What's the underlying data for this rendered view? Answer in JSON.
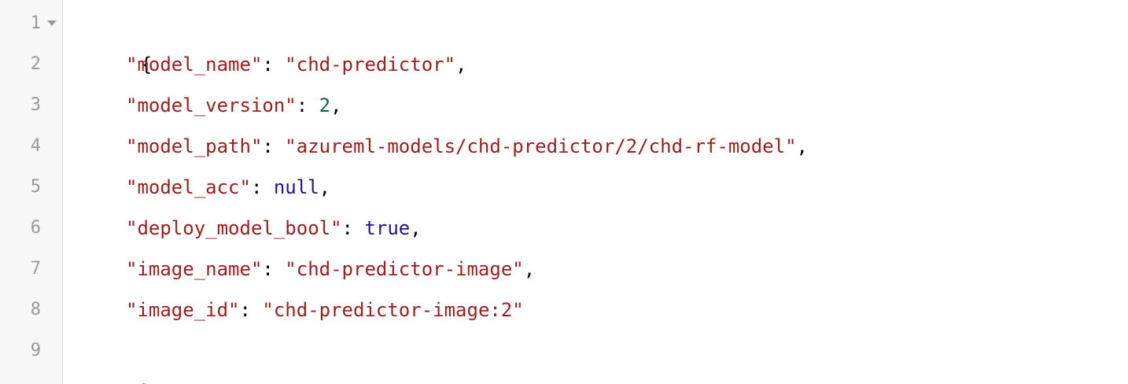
{
  "gutter": {
    "line_numbers": [
      "1",
      "2",
      "3",
      "4",
      "5",
      "6",
      "7",
      "8",
      "9"
    ]
  },
  "code": {
    "open_brace": "{",
    "close_brace": "}",
    "entries": [
      {
        "key": "\"model_name\"",
        "value": "\"chd-predictor\"",
        "comma": ","
      },
      {
        "key": "\"model_version\"",
        "value": "2",
        "comma": ","
      },
      {
        "key": "\"model_path\"",
        "value": "\"azureml-models/chd-predictor/2/chd-rf-model\"",
        "comma": ","
      },
      {
        "key": "\"model_acc\"",
        "value": "null",
        "comma": ","
      },
      {
        "key": "\"deploy_model_bool\"",
        "value": "true",
        "comma": ","
      },
      {
        "key": "\"image_name\"",
        "value": "\"chd-predictor-image\"",
        "comma": ","
      },
      {
        "key": "\"image_id\"",
        "value": "\"chd-predictor-image:2\"",
        "comma": ""
      }
    ],
    "colon": ": "
  },
  "colors": {
    "string": "#a11c1c",
    "number": "#116644",
    "keyword": "#221199",
    "line_number": "#999999",
    "gutter_background": "#f7f7f7"
  },
  "icons": {
    "fold": "fold-arrow-icon"
  }
}
